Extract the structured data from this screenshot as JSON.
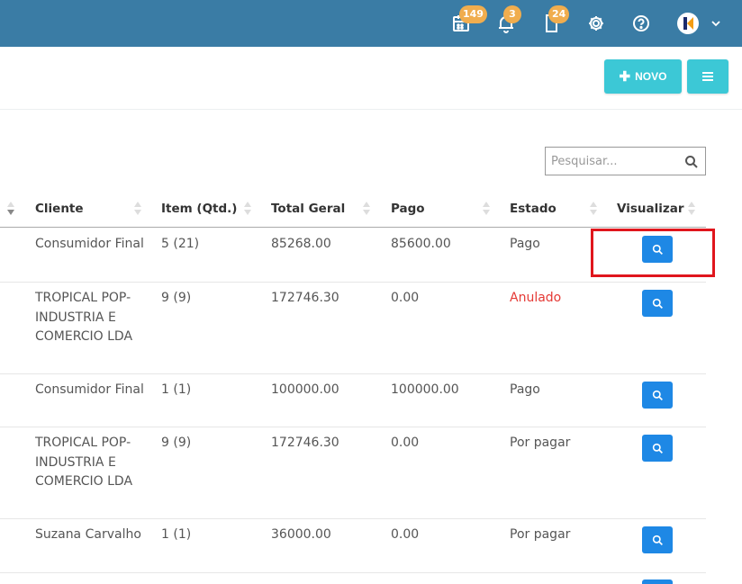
{
  "topbar": {
    "badges": {
      "calendar": "149",
      "notifications": "3",
      "documents": "24"
    },
    "icons": [
      "calendar-icon",
      "bell-icon",
      "document-icon",
      "gear-icon",
      "help-icon",
      "avatar",
      "chevron-down-icon"
    ]
  },
  "actions": {
    "novo_label": "NOVO"
  },
  "search": {
    "placeholder": "Pesquisar..."
  },
  "table": {
    "headers": {
      "cliente": "Cliente",
      "item": "Item (Qtd.)",
      "total": "Total Geral",
      "pago": "Pago",
      "estado": "Estado",
      "visualizar": "Visualizar"
    },
    "rows": [
      {
        "cliente": "Consumidor Final",
        "item": "5 (21)",
        "total": "85268.00",
        "pago": "85600.00",
        "estado": "Pago"
      },
      {
        "cliente": "TROPICAL POP-INDUSTRIA E COMERCIO LDA",
        "item": "9 (9)",
        "total": "172746.30",
        "pago": "0.00",
        "estado": "Anulado"
      },
      {
        "cliente": "Consumidor Final",
        "item": "1 (1)",
        "total": "100000.00",
        "pago": "100000.00",
        "estado": "Pago"
      },
      {
        "cliente": "TROPICAL POP-INDUSTRIA E COMERCIO LDA",
        "item": "9 (9)",
        "total": "172746.30",
        "pago": "0.00",
        "estado": "Por pagar"
      },
      {
        "cliente": "Suzana Carvalho",
        "item": "1 (1)",
        "total": "36000.00",
        "pago": "0.00",
        "estado": "Por pagar"
      }
    ]
  },
  "colors": {
    "topbar": "#3a7ca5",
    "accent": "#3cc8d6",
    "view_button": "#1e88e5",
    "badge": "#f0ad4e",
    "anulado": "#e53935",
    "highlight": "#e0161d"
  }
}
